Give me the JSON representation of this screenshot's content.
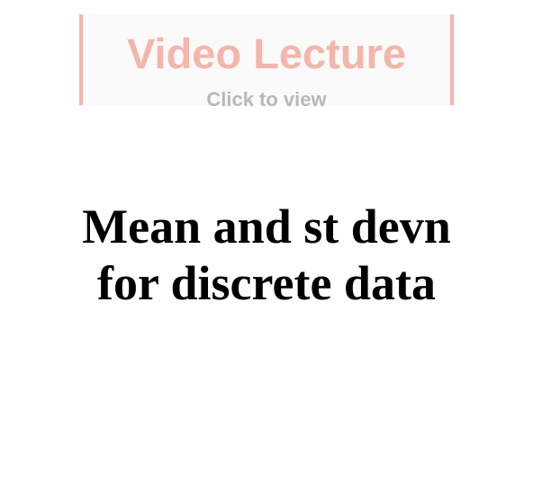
{
  "video_banner": {
    "title": "Video Lecture",
    "subtitle": "Click to view",
    "accent_color": "#f4b5ab",
    "subtitle_color": "#b8b8b8"
  },
  "slide": {
    "title_line1": "Mean and st devn",
    "title_line2": "for discrete data"
  }
}
